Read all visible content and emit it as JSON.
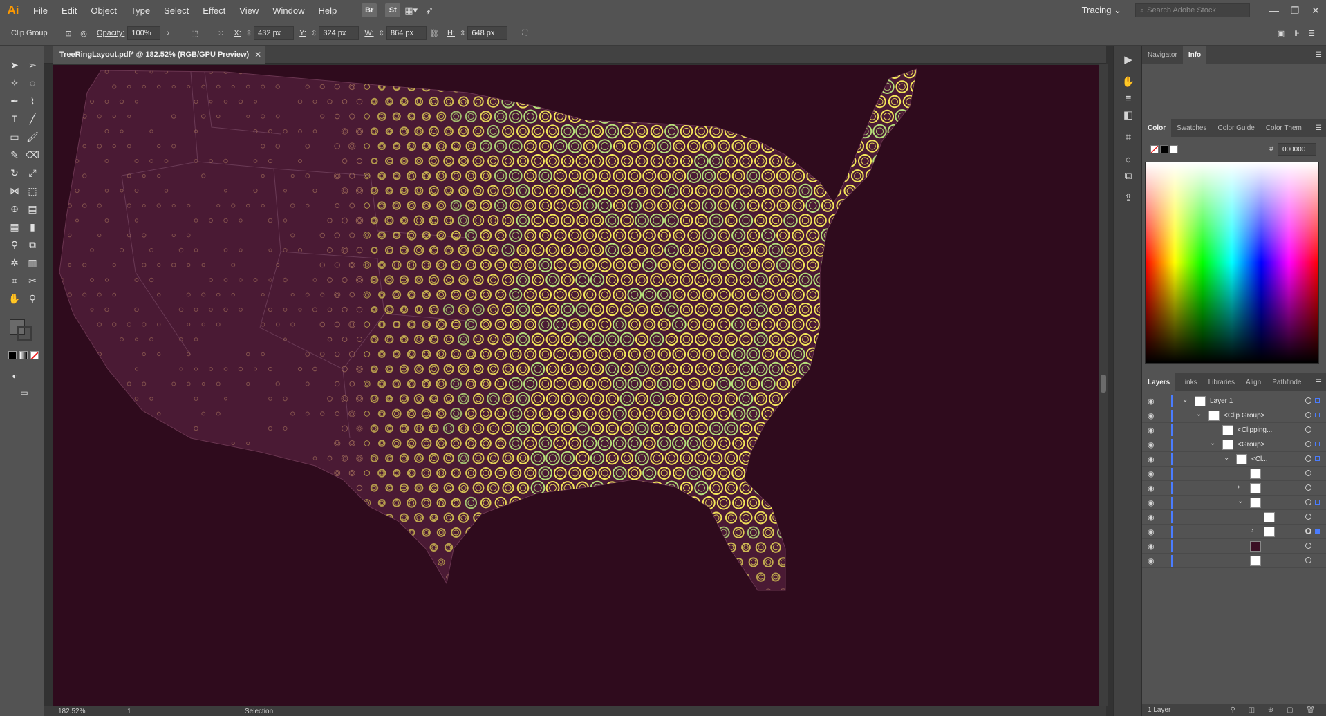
{
  "app": {
    "logo": "Ai"
  },
  "menu": [
    "File",
    "Edit",
    "Object",
    "Type",
    "Select",
    "Effect",
    "View",
    "Window",
    "Help"
  ],
  "bridge_buttons": [
    "Br",
    "St"
  ],
  "workspace": {
    "label": "Tracing"
  },
  "search_stock": {
    "placeholder": "Search Adobe Stock"
  },
  "control": {
    "selection": "Clip Group",
    "opacity_label": "Opacity:",
    "opacity_value": "100%",
    "x_label": "X:",
    "x_value": "432 px",
    "y_label": "Y:",
    "y_value": "324 px",
    "w_label": "W:",
    "w_value": "864 px",
    "h_label": "H:",
    "h_value": "648 px"
  },
  "document": {
    "tab_title": "TreeRingLayout.pdf* @ 182.52% (RGB/GPU Preview)"
  },
  "status": {
    "zoom": "182.52%",
    "page": "1",
    "mode": "Selection"
  },
  "panels": {
    "top_tabs": [
      "Navigator",
      "Info"
    ],
    "color_tabs": [
      "Color",
      "Swatches",
      "Color Guide",
      "Color Them"
    ],
    "hex_label": "#",
    "hex_value": "000000",
    "layers_tabs": [
      "Layers",
      "Links",
      "Libraries",
      "Align",
      "Pathfinde"
    ],
    "layers": [
      {
        "name": "Layer 1"
      },
      {
        "name": "<Clip Group>"
      },
      {
        "name": "<Clipping..."
      },
      {
        "name": "<Group>"
      },
      {
        "name": "<Cl..."
      },
      {
        "name": ""
      },
      {
        "name": ""
      },
      {
        "name": ""
      },
      {
        "name": ""
      },
      {
        "name": ""
      },
      {
        "name": ""
      },
      {
        "name": ""
      }
    ],
    "layers_footer": "1 Layer"
  },
  "colors": {
    "canvas": "#2f0b1d",
    "map": "#4a1a34",
    "ring_dim": "#c8956a",
    "ring_bright": "#f3e65a",
    "ring_green": "#b6e07a"
  }
}
